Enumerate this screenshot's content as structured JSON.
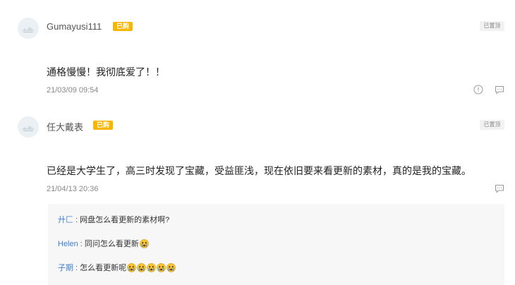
{
  "comments": [
    {
      "username": "Gumayusi111",
      "badge": "已购",
      "pinned": "已置顶",
      "text": "通格慢慢！我彻底爱了！！",
      "time": "21/03/09 09:54"
    },
    {
      "username": "任大戴表",
      "badge": "已购",
      "pinned": "已置顶",
      "text": "已经是大学生了，高三时发现了宝藏，受益匪浅，现在依旧要来看更新的素材，真的是我的宝藏。",
      "time": "21/04/13 20:36",
      "replies": [
        {
          "name": "廾匚",
          "sep": " : ",
          "text": "网盘怎么看更新的素材啊?",
          "emoji_count": 0
        },
        {
          "name": "Helen",
          "sep": " : ",
          "text": "同问怎么看更新",
          "emoji_count": 1
        },
        {
          "name": "子期",
          "sep": " : ",
          "text": "怎么看更新呢",
          "emoji_count": 5
        }
      ]
    }
  ],
  "icons": {
    "report": "exclamation-circle-icon",
    "reply": "comment-bubble-icon",
    "emoji": "crying-face-emoji"
  },
  "colors": {
    "badge": "#f7b500",
    "reply_name": "#3f7fd1",
    "reply_bg": "#f7f7f7"
  }
}
